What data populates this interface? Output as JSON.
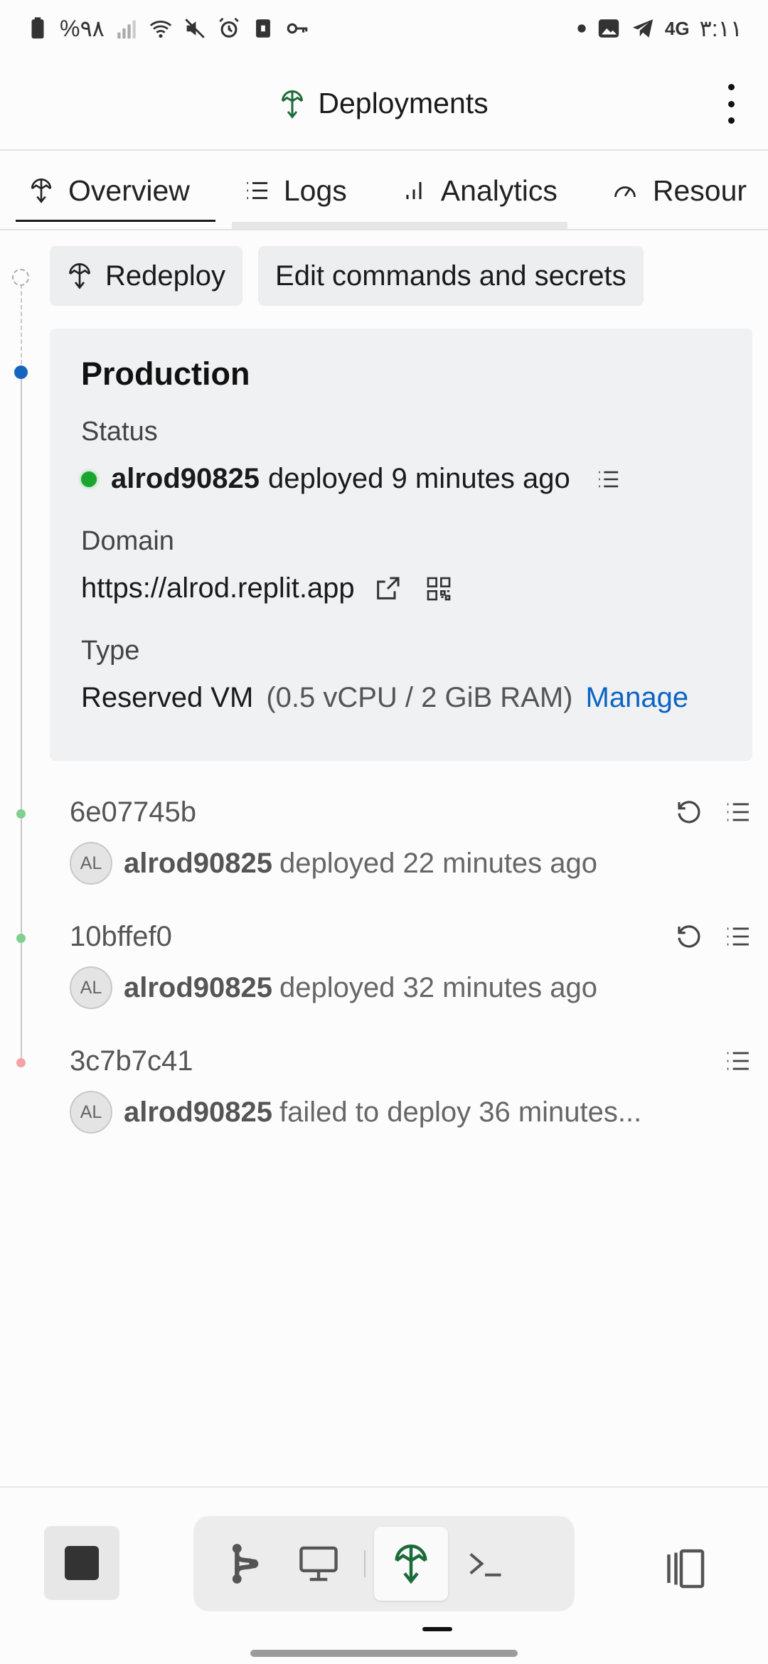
{
  "status_bar": {
    "battery": "%۹۸",
    "network": "4G",
    "time": "۳:۱۱"
  },
  "header": {
    "title": "Deployments",
    "menu_icon": "more-vertical-icon"
  },
  "tabs": [
    {
      "label": "Overview",
      "icon": "deploy-icon",
      "active": true
    },
    {
      "label": "Logs",
      "icon": "list-icon",
      "active": false
    },
    {
      "label": "Analytics",
      "icon": "bar-chart-icon",
      "active": false
    },
    {
      "label": "Resour",
      "icon": "gauge-icon",
      "active": false
    }
  ],
  "actions": {
    "redeploy_label": "Redeploy",
    "edit_label": "Edit commands and secrets"
  },
  "production": {
    "title": "Production",
    "status_label": "Status",
    "status_user": "alrod90825",
    "status_text": "deployed 9 minutes ago",
    "domain_label": "Domain",
    "domain_value": "https://alrod.replit.app",
    "type_label": "Type",
    "type_value": "Reserved VM",
    "type_detail": "(0.5 vCPU / 2 GiB RAM)",
    "manage_label": "Manage"
  },
  "history": [
    {
      "hash": "6e07745b",
      "avatar": "AL",
      "user": "alrod90825",
      "text": "deployed 22 minutes ago",
      "state": "success",
      "can_rollback": true
    },
    {
      "hash": "10bffef0",
      "avatar": "AL",
      "user": "alrod90825",
      "text": "deployed 32 minutes ago",
      "state": "success",
      "can_rollback": true
    },
    {
      "hash": "3c7b7c41",
      "avatar": "AL",
      "user": "alrod90825",
      "text": "failed to deploy 36 minutes...",
      "state": "failed",
      "can_rollback": false
    }
  ],
  "colors": {
    "accent": "#0b63c4",
    "brand_green": "#1c6b3a",
    "status_green": "#1aa530",
    "timeline_blue": "#1565c0",
    "success_dot": "#7fd08f",
    "failed_dot": "#f3a3a3"
  }
}
